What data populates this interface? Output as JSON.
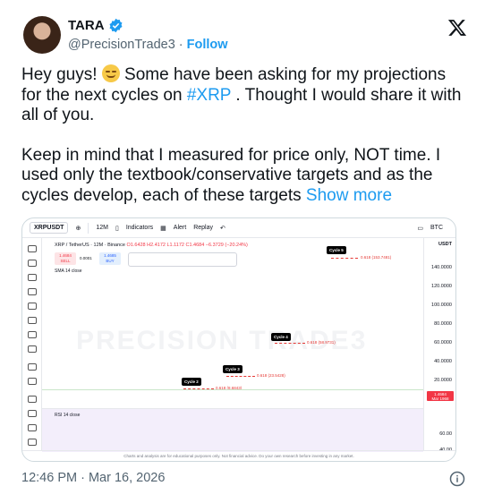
{
  "author": {
    "display_name": "TARA",
    "handle": "@PrecisionTrade3",
    "separator": "·",
    "follow_label": "Follow"
  },
  "tweet": {
    "para1_a": "Hey guys! ",
    "para1_b": " Some have been asking for my projections for the next cycles on ",
    "hashtag": "#XRP",
    "para1_c": " . Thought I would share it with all of you.",
    "para2": "Keep in mind that I measured for price only, NOT time. I used only the textbook/conservative targets and as the cycles develop, each of these targets ",
    "show_more": "Show more",
    "timestamp": "12:46 PM · Mar 16, 2026"
  },
  "chart_screenshot": {
    "symbol": "XRPUSDT",
    "interval": "12M",
    "indicators_label": "Indicators",
    "alert_label": "Alert",
    "replay_label": "Replay",
    "quote_currency": "BTC",
    "axis_currency": "USDT",
    "pair_title": "XRP / TetherUS · 12M · Binance",
    "ohlc": "O1.6428 H2.4172 L1.1172 C1.4684 −6.3729 (−20.24%)",
    "sell_price": "1.4684",
    "sell_label": "SELL",
    "spread": "0.0001",
    "buy_price": "1.4685",
    "buy_label": "BUY",
    "sma_label": "SMA 14 close",
    "rsi_label": "RSI 14 close",
    "watermark": "PRECISION TRADE3",
    "current_price": "1.4684",
    "current_price_sub": "Mar 1968",
    "footer_note": "Charts and analysis are for educational purposes only. Not financial advice. Do your own research before investing in any market.",
    "price_axis": [
      "140.0000",
      "120.0000",
      "100.0000",
      "80.0000",
      "60.0000",
      "40.0000",
      "20.0000"
    ],
    "rsi_axis": [
      "60.00",
      "40.00"
    ],
    "cycles": [
      {
        "label": "Cycle 5",
        "target": "0.618 (153.7481)"
      },
      {
        "label": "Cycle 4",
        "target": "0.618 (58.9731)"
      },
      {
        "label": "Cycle 3",
        "target": "0.618 (23.5428)"
      },
      {
        "label": "Cycle 2",
        "target": "0.618 (8.6843)"
      }
    ]
  },
  "colors": {
    "accent": "#1d9bf0",
    "text": "#0f1419",
    "muted": "#536471",
    "target_red": "#e53935"
  }
}
